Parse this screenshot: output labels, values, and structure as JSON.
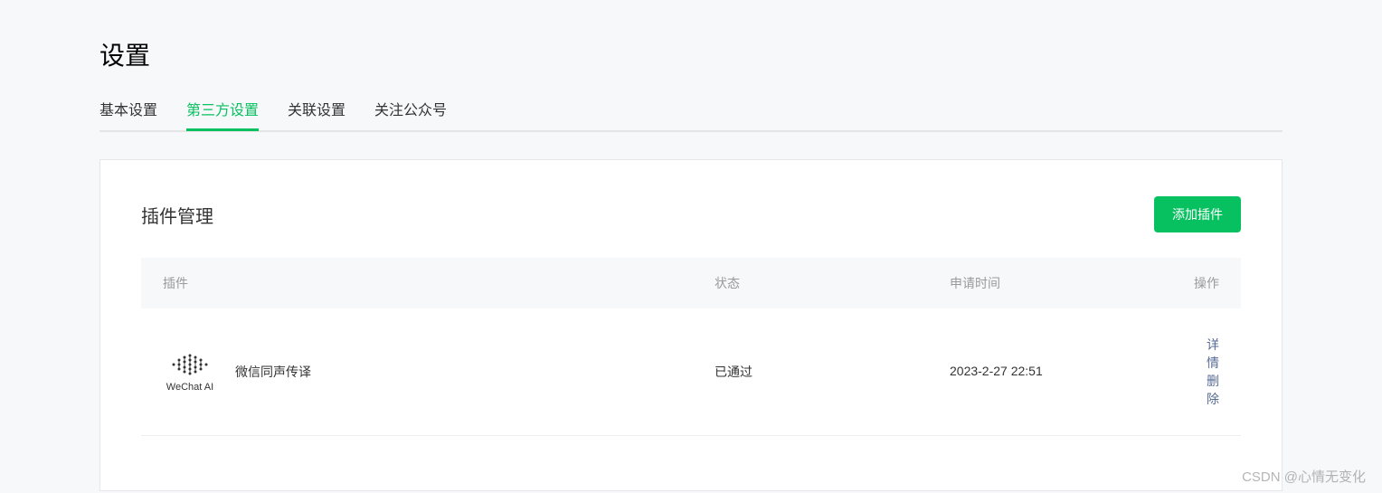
{
  "page": {
    "title": "设置"
  },
  "tabs": [
    {
      "label": "基本设置",
      "active": false
    },
    {
      "label": "第三方设置",
      "active": true
    },
    {
      "label": "关联设置",
      "active": false
    },
    {
      "label": "关注公众号",
      "active": false
    }
  ],
  "panel": {
    "title": "插件管理",
    "addButton": "添加插件"
  },
  "table": {
    "headers": {
      "plugin": "插件",
      "status": "状态",
      "time": "申请时间",
      "action": "操作"
    },
    "rows": [
      {
        "iconLabel": "WeChat AI",
        "name": "微信同声传译",
        "status": "已通过",
        "time": "2023-2-27 22:51",
        "actions": {
          "detail": "详情",
          "delete": "删除"
        }
      }
    ]
  },
  "watermark": "CSDN @心情无变化"
}
